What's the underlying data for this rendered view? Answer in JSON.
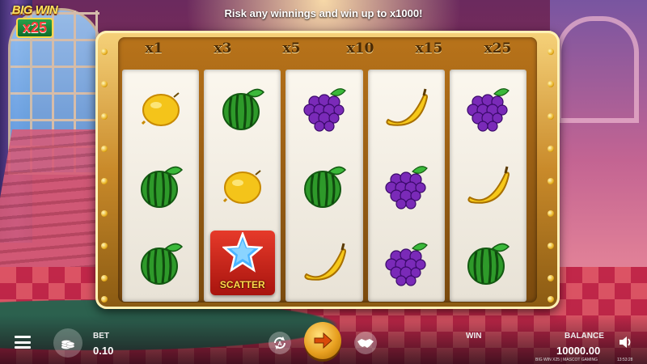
{
  "logo": {
    "title": "BIG WIN",
    "multiplier": "x25"
  },
  "banner": "Risk any winnings and win up to x1000!",
  "multipliers": [
    "x1",
    "x3",
    "x5",
    "x10",
    "x15",
    "x25"
  ],
  "reels": [
    [
      "lemon",
      "watermelon",
      "watermelon"
    ],
    [
      "watermelon",
      "lemon",
      "scatter"
    ],
    [
      "grapes",
      "watermelon",
      "banana"
    ],
    [
      "banana",
      "grapes",
      "grapes"
    ],
    [
      "grapes",
      "banana",
      "watermelon"
    ]
  ],
  "scatter_label": "SCATTER",
  "bet": {
    "label": "BET",
    "value": "0.10"
  },
  "win": {
    "label": "WIN"
  },
  "balance": {
    "label": "BALANCE",
    "value": "10000.00"
  },
  "footer": "BIG WIN X25 | MASCOT GAMING",
  "clock": "13:53:28",
  "icons": {
    "menu": "menu-icon",
    "coins": "coin-stack-icon",
    "autoplay": "autoplay-icon",
    "spin": "spin-arrow-icon",
    "turbo": "handshake-icon",
    "sound": "speaker-icon"
  },
  "colors": {
    "frame_gold": "#c98a2a",
    "spin_gold": "#e8a020",
    "scatter_red": "#d62a1e"
  }
}
